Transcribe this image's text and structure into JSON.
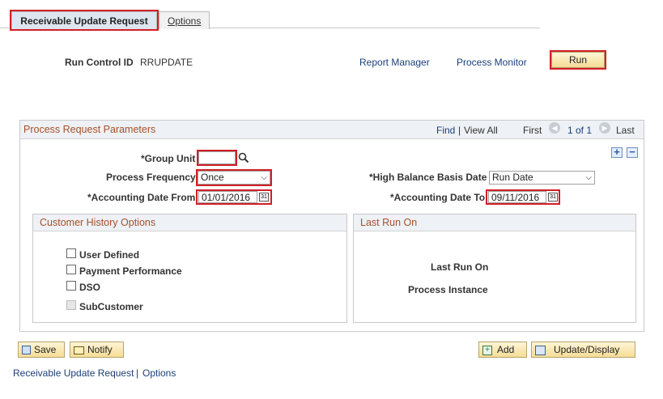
{
  "tabs": [
    {
      "label": "Receivable Update Request",
      "active": true
    },
    {
      "label": "Options",
      "active": false
    }
  ],
  "header": {
    "run_control_label": "Run Control ID",
    "run_control_value": "RRUPDATE",
    "report_manager": "Report Manager",
    "process_monitor": "Process Monitor",
    "run_button": "Run"
  },
  "params": {
    "title": "Process Request Parameters",
    "find": "Find",
    "sep": "|",
    "view_all": "View All",
    "first": "First",
    "counter": "1 of 1",
    "last": "Last",
    "group_unit_label": "*Group Unit",
    "group_unit_value": "",
    "process_frequency_label": "Process Frequency",
    "process_frequency_value": "Once",
    "high_balance_label": "*High Balance Basis Date",
    "high_balance_value": "Run Date",
    "acct_from_label": "*Accounting Date From",
    "acct_from_value": "01/01/2016",
    "acct_to_label": "*Accounting Date To",
    "acct_to_value": "09/11/2016"
  },
  "customer_history": {
    "title": "Customer History Options",
    "items": [
      {
        "label": "User Defined",
        "checked": false,
        "disabled": false
      },
      {
        "label": "Payment Performance",
        "checked": false,
        "disabled": false
      },
      {
        "label": "DSO",
        "checked": false,
        "disabled": false
      },
      {
        "label": "SubCustomer",
        "checked": false,
        "disabled": true
      }
    ]
  },
  "last_run": {
    "title": "Last Run On",
    "last_run_label": "Last Run On",
    "process_instance_label": "Process Instance"
  },
  "footer": {
    "save": "Save",
    "notify": "Notify",
    "add": "Add",
    "update_display": "Update/Display",
    "link1": "Receivable Update Request",
    "sep": "|",
    "link2": "Options"
  },
  "colors": {
    "highlight": "#d21f26",
    "section_title": "#a5512a",
    "link": "#1c3f78"
  },
  "icons": {
    "lookup": "magnifier-icon",
    "calendar": "calendar-icon",
    "nav_prev": "previous-arrow-icon",
    "nav_next": "next-arrow-icon",
    "add_row": "plus-icon",
    "delete_row": "minus-icon",
    "save": "save-icon",
    "notify": "notify-icon",
    "add": "add-icon",
    "update": "update-icon"
  }
}
